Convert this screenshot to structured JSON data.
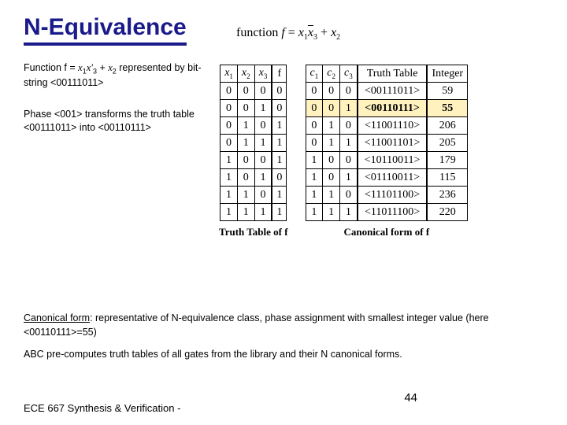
{
  "title": "N-Equivalence",
  "formula": {
    "prefix": "function ",
    "lhs": "f",
    "eq": " = ",
    "t1": "x",
    "s1": "1",
    "t2": "x",
    "s2": "3",
    "plus": " + ",
    "t3": "x",
    "s3": "2"
  },
  "desc1": {
    "pre": "Function  f = ",
    "x1": "x",
    "x1s": "1",
    "x3": "x'",
    "x3s": "3",
    "plus": " + ",
    "x2": "x",
    "x2s": "2",
    "post": " represented by bit-string                  <00111011>"
  },
  "desc2": "Phase <001> transforms the truth table <00111011> into <00110111>",
  "truth_f": {
    "headers": [
      "x₁",
      "x₂",
      "x₃",
      "f"
    ],
    "rows": [
      [
        "0",
        "0",
        "0",
        "0"
      ],
      [
        "0",
        "0",
        "1",
        "0"
      ],
      [
        "0",
        "1",
        "0",
        "1"
      ],
      [
        "0",
        "1",
        "1",
        "1"
      ],
      [
        "1",
        "0",
        "0",
        "1"
      ],
      [
        "1",
        "0",
        "1",
        "0"
      ],
      [
        "1",
        "1",
        "0",
        "1"
      ],
      [
        "1",
        "1",
        "1",
        "1"
      ]
    ],
    "caption": "Truth Table of f"
  },
  "canon": {
    "headers": [
      "c₁",
      "c₂",
      "c₃",
      "Truth Table",
      "Integer"
    ],
    "rows": [
      {
        "c": [
          "0",
          "0",
          "0"
        ],
        "tt": "<00111011>",
        "int": "59",
        "hl": false
      },
      {
        "c": [
          "0",
          "0",
          "1"
        ],
        "tt": "<00110111>",
        "int": "55",
        "hl": true
      },
      {
        "c": [
          "0",
          "1",
          "0"
        ],
        "tt": "<11001110>",
        "int": "206",
        "hl": false
      },
      {
        "c": [
          "0",
          "1",
          "1"
        ],
        "tt": "<11001101>",
        "int": "205",
        "hl": false
      },
      {
        "c": [
          "1",
          "0",
          "0"
        ],
        "tt": "<10110011>",
        "int": "179",
        "hl": false
      },
      {
        "c": [
          "1",
          "0",
          "1"
        ],
        "tt": "<01110011>",
        "int": "115",
        "hl": false
      },
      {
        "c": [
          "1",
          "1",
          "0"
        ],
        "tt": "<11101100>",
        "int": "236",
        "hl": false
      },
      {
        "c": [
          "1",
          "1",
          "1"
        ],
        "tt": "<11011100>",
        "int": "220",
        "hl": false
      }
    ],
    "caption": "Canonical form of f"
  },
  "bottom": {
    "p1a": "Canonical form",
    "p1b": ": representative of N-equivalence class, phase assignment with smallest integer value (here <00110111>=55)",
    "p2": "ABC pre-computes truth tables of all gates from the library and their N canonical forms."
  },
  "footer": "ECE 667 Synthesis & Verification -",
  "page": "44"
}
